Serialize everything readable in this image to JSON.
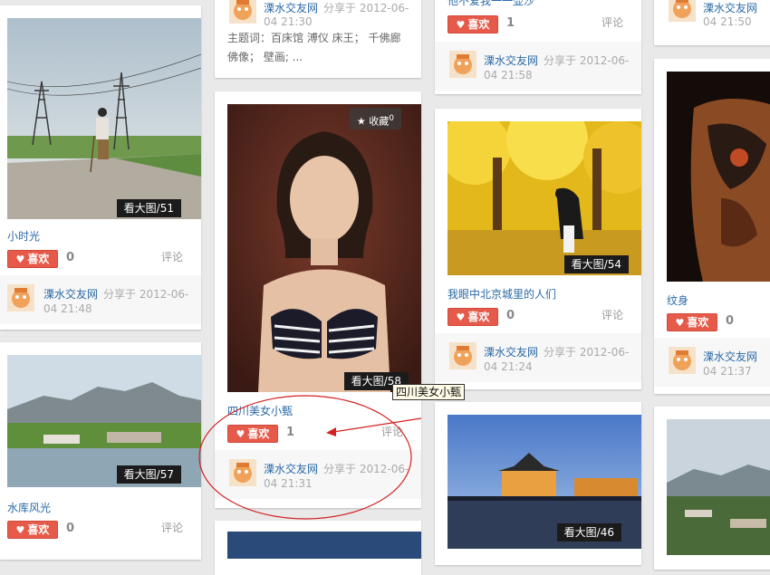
{
  "colors": {
    "accent_red": "#e65a4a",
    "link_blue": "#2b6aa6",
    "annotation_red": "#d32020"
  },
  "share_user": "溧水交友网",
  "share_verb": "分享于",
  "like_label": "喜欢",
  "comment_label": "评论",
  "cards": [
    {
      "title": "小时光",
      "big_image_label": "看大图/51",
      "likes": "0",
      "date_part1": "2012-06-",
      "date_part2": "04 21:48"
    },
    {
      "title": "水库风光",
      "big_image_label": "看大图/57",
      "likes": "0"
    },
    {
      "date_part1": "2012-06-",
      "date_part2": "04 21:30",
      "description": "主题词：百床馆 溥仪 床王； 千佛廊 佛像； 壁画; ..."
    },
    {
      "title": "四川美女小甄",
      "big_image_label": "看大图/58",
      "likes": "1",
      "favorite_label": "收藏",
      "favorite_count": "0",
      "date_part1": "2012-06-",
      "date_part2": "04 21:31",
      "tooltip": "四川美女小甄"
    },
    {
      "title_partial": "他不爱我一一壶沙",
      "likes": "1",
      "date_part1": "2012-06-",
      "date_part2": "04 21:58"
    },
    {
      "title": "我眼中北京城里的人们",
      "big_image_label": "看大图/54",
      "likes": "0",
      "date_part1": "2012-06-",
      "date_part2": "04 21:24"
    },
    {
      "big_image_label": "看大图/46"
    },
    {
      "date_part2": "04 21:50"
    },
    {
      "title": "纹身",
      "likes": "0",
      "date_part2": "04 21:37"
    }
  ]
}
